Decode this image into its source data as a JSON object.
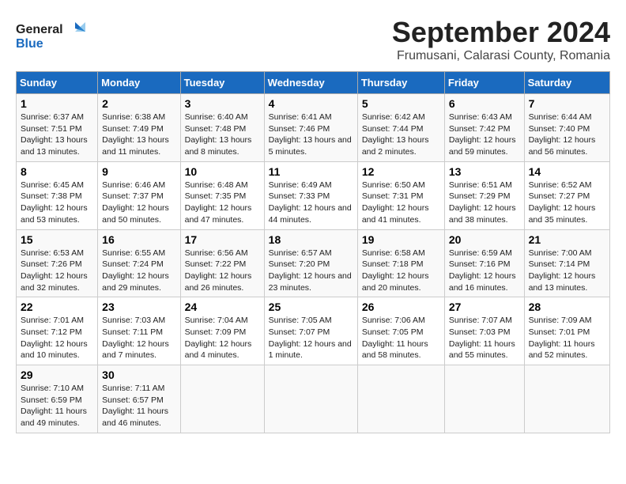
{
  "logo": {
    "line1": "General",
    "line2": "Blue"
  },
  "title": "September 2024",
  "subtitle": "Frumusani, Calarasi County, Romania",
  "days_of_week": [
    "Sunday",
    "Monday",
    "Tuesday",
    "Wednesday",
    "Thursday",
    "Friday",
    "Saturday"
  ],
  "weeks": [
    [
      {
        "day": "1",
        "sunrise": "6:37 AM",
        "sunset": "7:51 PM",
        "daylight": "13 hours and 13 minutes."
      },
      {
        "day": "2",
        "sunrise": "6:38 AM",
        "sunset": "7:49 PM",
        "daylight": "13 hours and 11 minutes."
      },
      {
        "day": "3",
        "sunrise": "6:40 AM",
        "sunset": "7:48 PM",
        "daylight": "13 hours and 8 minutes."
      },
      {
        "day": "4",
        "sunrise": "6:41 AM",
        "sunset": "7:46 PM",
        "daylight": "13 hours and 5 minutes."
      },
      {
        "day": "5",
        "sunrise": "6:42 AM",
        "sunset": "7:44 PM",
        "daylight": "13 hours and 2 minutes."
      },
      {
        "day": "6",
        "sunrise": "6:43 AM",
        "sunset": "7:42 PM",
        "daylight": "12 hours and 59 minutes."
      },
      {
        "day": "7",
        "sunrise": "6:44 AM",
        "sunset": "7:40 PM",
        "daylight": "12 hours and 56 minutes."
      }
    ],
    [
      {
        "day": "8",
        "sunrise": "6:45 AM",
        "sunset": "7:38 PM",
        "daylight": "12 hours and 53 minutes."
      },
      {
        "day": "9",
        "sunrise": "6:46 AM",
        "sunset": "7:37 PM",
        "daylight": "12 hours and 50 minutes."
      },
      {
        "day": "10",
        "sunrise": "6:48 AM",
        "sunset": "7:35 PM",
        "daylight": "12 hours and 47 minutes."
      },
      {
        "day": "11",
        "sunrise": "6:49 AM",
        "sunset": "7:33 PM",
        "daylight": "12 hours and 44 minutes."
      },
      {
        "day": "12",
        "sunrise": "6:50 AM",
        "sunset": "7:31 PM",
        "daylight": "12 hours and 41 minutes."
      },
      {
        "day": "13",
        "sunrise": "6:51 AM",
        "sunset": "7:29 PM",
        "daylight": "12 hours and 38 minutes."
      },
      {
        "day": "14",
        "sunrise": "6:52 AM",
        "sunset": "7:27 PM",
        "daylight": "12 hours and 35 minutes."
      }
    ],
    [
      {
        "day": "15",
        "sunrise": "6:53 AM",
        "sunset": "7:26 PM",
        "daylight": "12 hours and 32 minutes."
      },
      {
        "day": "16",
        "sunrise": "6:55 AM",
        "sunset": "7:24 PM",
        "daylight": "12 hours and 29 minutes."
      },
      {
        "day": "17",
        "sunrise": "6:56 AM",
        "sunset": "7:22 PM",
        "daylight": "12 hours and 26 minutes."
      },
      {
        "day": "18",
        "sunrise": "6:57 AM",
        "sunset": "7:20 PM",
        "daylight": "12 hours and 23 minutes."
      },
      {
        "day": "19",
        "sunrise": "6:58 AM",
        "sunset": "7:18 PM",
        "daylight": "12 hours and 20 minutes."
      },
      {
        "day": "20",
        "sunrise": "6:59 AM",
        "sunset": "7:16 PM",
        "daylight": "12 hours and 16 minutes."
      },
      {
        "day": "21",
        "sunrise": "7:00 AM",
        "sunset": "7:14 PM",
        "daylight": "12 hours and 13 minutes."
      }
    ],
    [
      {
        "day": "22",
        "sunrise": "7:01 AM",
        "sunset": "7:12 PM",
        "daylight": "12 hours and 10 minutes."
      },
      {
        "day": "23",
        "sunrise": "7:03 AM",
        "sunset": "7:11 PM",
        "daylight": "12 hours and 7 minutes."
      },
      {
        "day": "24",
        "sunrise": "7:04 AM",
        "sunset": "7:09 PM",
        "daylight": "12 hours and 4 minutes."
      },
      {
        "day": "25",
        "sunrise": "7:05 AM",
        "sunset": "7:07 PM",
        "daylight": "12 hours and 1 minute."
      },
      {
        "day": "26",
        "sunrise": "7:06 AM",
        "sunset": "7:05 PM",
        "daylight": "11 hours and 58 minutes."
      },
      {
        "day": "27",
        "sunrise": "7:07 AM",
        "sunset": "7:03 PM",
        "daylight": "11 hours and 55 minutes."
      },
      {
        "day": "28",
        "sunrise": "7:09 AM",
        "sunset": "7:01 PM",
        "daylight": "11 hours and 52 minutes."
      }
    ],
    [
      {
        "day": "29",
        "sunrise": "7:10 AM",
        "sunset": "6:59 PM",
        "daylight": "11 hours and 49 minutes."
      },
      {
        "day": "30",
        "sunrise": "7:11 AM",
        "sunset": "6:57 PM",
        "daylight": "11 hours and 46 minutes."
      },
      null,
      null,
      null,
      null,
      null
    ]
  ],
  "labels": {
    "sunrise": "Sunrise:",
    "sunset": "Sunset:",
    "daylight": "Daylight:"
  }
}
